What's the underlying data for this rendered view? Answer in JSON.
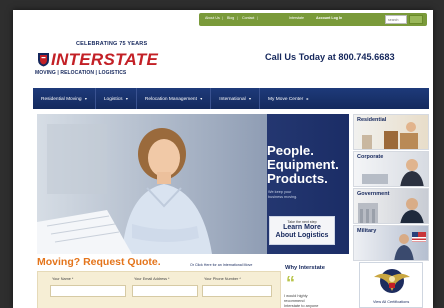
{
  "utility": {
    "about_us": "About Us",
    "blog": "Blog",
    "contact": "Contact",
    "tab4": "Interstate",
    "account_login": "Account Log In",
    "sep": "|",
    "search_placeholder": "search"
  },
  "header": {
    "celebrating": "CELEBRATING 75 YEARS",
    "logo_word": "INTERSTATE",
    "tagline": "MOVING | RELOCATION | LOGISTICS",
    "call_us": "Call Us Today at 800.745.6683"
  },
  "nav": {
    "items": [
      {
        "label": "Residential Moving",
        "caret": "▾"
      },
      {
        "label": "Logistics",
        "caret": "▾"
      },
      {
        "label": "Relocation Management",
        "caret": "▾"
      },
      {
        "label": "International",
        "caret": "▾"
      },
      {
        "label": "My Move Center",
        "caret": "▸"
      }
    ]
  },
  "hero": {
    "headline_1": "People.",
    "headline_2": "Equipment.",
    "headline_3": "Products.",
    "sub_1": "We keep your",
    "sub_2": "business moving.",
    "cta_small": "Take the next step",
    "cta_big_1": "Learn More",
    "cta_big_2": "About Logistics"
  },
  "tiles": [
    {
      "label": "Residential"
    },
    {
      "label": "Corporate"
    },
    {
      "label": "Government"
    },
    {
      "label": "Military"
    }
  ],
  "quote": {
    "title": "Moving? Request Quote.",
    "intl_link": "Or Click Here for an International Move",
    "name_label": "Your Name *",
    "email_label": "Your Email Address *",
    "phone_label": "Your Phone Number *"
  },
  "why": {
    "title": "Why Interstate",
    "quote_mark": "“",
    "text_1": "I would highly",
    "text_2": "recommend",
    "text_3": "Interstate to anyone"
  },
  "certifications": {
    "link": "View All Certifications"
  },
  "colors": {
    "navy": "#15275c",
    "brand_red": "#c32026",
    "orange": "#e4751c",
    "util_green": "#7a9a3a"
  }
}
